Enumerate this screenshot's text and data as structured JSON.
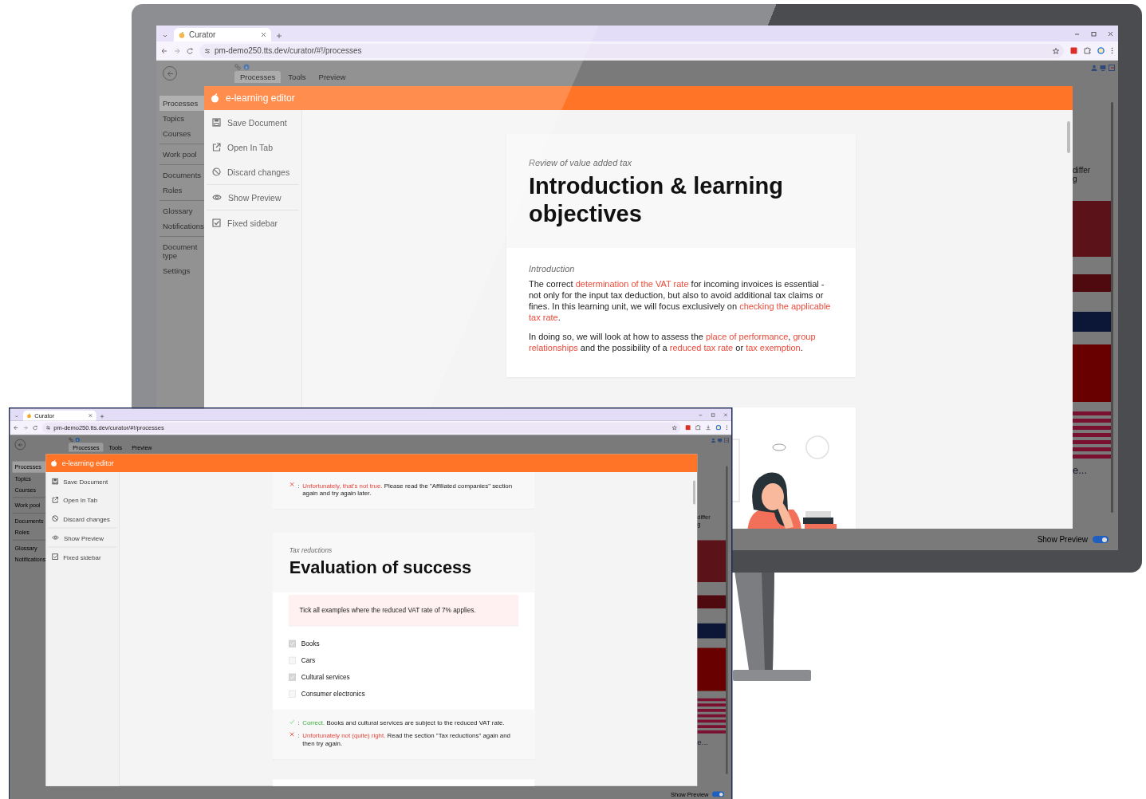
{
  "monitor_window": {
    "browser": {
      "tab_title": "Curator",
      "url": "pm-demo250.tts.dev/curator/#!/processes",
      "toolbar_icons": [
        {
          "kind": "extension"
        },
        {
          "kind": "puzzle"
        },
        {
          "kind": "profile"
        }
      ]
    },
    "app": {
      "tabs": [
        {
          "label": "Processes",
          "selected": true
        },
        {
          "label": "Tools",
          "selected": false
        },
        {
          "label": "Preview",
          "selected": false
        }
      ],
      "nav_groups": [
        [
          {
            "label": "Processes",
            "selected": true
          },
          {
            "label": "Topics",
            "selected": false
          },
          {
            "label": "Courses",
            "selected": false
          }
        ],
        [
          {
            "label": "Work pool",
            "selected": false
          }
        ],
        [
          {
            "label": "Documents",
            "selected": false
          },
          {
            "label": "Roles",
            "selected": false
          }
        ],
        [
          {
            "label": "Glossary",
            "selected": false
          },
          {
            "label": "Notifications",
            "selected": false
          }
        ],
        [
          {
            "label": "Document type",
            "selected": false
          },
          {
            "label": "Settings",
            "selected": false
          }
        ]
      ],
      "side_texts": [
        "differ",
        "g",
        "e..."
      ],
      "status": {
        "label": "Show Preview",
        "on": true
      }
    },
    "dialog": {
      "title": "e-learning editor",
      "menu_groups": [
        [
          {
            "kind": "save",
            "label": "Save Document"
          },
          {
            "kind": "open-tab",
            "label": "Open In Tab"
          },
          {
            "kind": "discard",
            "label": "Discard changes"
          }
        ],
        [
          {
            "kind": "preview",
            "label": "Show Preview"
          }
        ],
        [
          {
            "kind": "checkbox",
            "label": "Fixed sidebar",
            "checked": true
          }
        ]
      ],
      "blocks": [
        {
          "kind": "lesson",
          "subtitle": "Review of value added tax",
          "title": "Introduction & learning objectives",
          "section_label": "Introduction",
          "paragraphs": [
            [
              {
                "text": "The correct ",
                "term": false
              },
              {
                "text": "determination of the VAT rate",
                "term": true
              },
              {
                "text": " for incoming invoices is essential - not only for the input tax deduction, but also to avoid additional tax claims or fines. In this learning unit, we will focus exclusively on ",
                "term": false
              },
              {
                "text": "checking the applicable tax rate",
                "term": true
              },
              {
                "text": ".",
                "term": false
              }
            ],
            [
              {
                "text": "In doing so, we will look at how to assess the ",
                "term": false
              },
              {
                "text": "place of performance",
                "term": true
              },
              {
                "text": ", ",
                "term": false
              },
              {
                "text": "group relationships",
                "term": true
              },
              {
                "text": " and the possibility of a ",
                "term": false
              },
              {
                "text": "reduced tax rate",
                "term": true
              },
              {
                "text": " or ",
                "term": false
              },
              {
                "text": "tax exemption",
                "term": true
              },
              {
                "text": ".",
                "term": false
              }
            ]
          ]
        },
        {
          "kind": "illustration"
        }
      ]
    }
  },
  "front_window": {
    "browser": {
      "tab_title": "Curator",
      "url": "pm-demo250.tts.dev/curator/#!/processes",
      "toolbar_icons": [
        {
          "kind": "extension"
        },
        {
          "kind": "puzzle"
        },
        {
          "kind": "download"
        },
        {
          "kind": "profile"
        }
      ]
    },
    "app": {
      "tabs": [
        {
          "label": "Processes",
          "selected": true
        },
        {
          "label": "Tools",
          "selected": false
        },
        {
          "label": "Preview",
          "selected": false
        }
      ],
      "nav_groups": [
        [
          {
            "label": "Processes",
            "selected": true
          },
          {
            "label": "Topics",
            "selected": false
          },
          {
            "label": "Courses",
            "selected": false
          }
        ],
        [
          {
            "label": "Work pool",
            "selected": false
          }
        ],
        [
          {
            "label": "Documents",
            "selected": false
          },
          {
            "label": "Roles",
            "selected": false
          }
        ],
        [
          {
            "label": "Glossary",
            "selected": false
          },
          {
            "label": "Notifications",
            "selected": false
          }
        ]
      ],
      "side_texts": [
        "differ",
        "g",
        "e..."
      ],
      "status": {
        "label": "Show Preview",
        "on": true
      }
    },
    "dialog": {
      "title": "e-learning editor",
      "menu_groups": [
        [
          {
            "kind": "save",
            "label": "Save Document"
          },
          {
            "kind": "open-tab",
            "label": "Open In Tab"
          },
          {
            "kind": "discard",
            "label": "Discard changes"
          }
        ],
        [
          {
            "kind": "preview",
            "label": "Show Preview"
          }
        ],
        [
          {
            "kind": "checkbox",
            "label": "Fixed sidebar",
            "checked": true
          }
        ]
      ],
      "blocks": [
        {
          "kind": "feedback-card",
          "feedback": [
            {
              "kind": "wrong",
              "separator": ":",
              "label": "Unfortunately, that's not true.",
              "text": "Please read the \"Affiliated companies\" section again and try again later."
            }
          ]
        },
        {
          "kind": "quiz",
          "subtitle": "Tax reductions",
          "title": "Evaluation of success",
          "question": "Tick all examples where the reduced VAT rate of 7% applies.",
          "options": [
            {
              "label": "Books",
              "checked": true
            },
            {
              "label": "Cars",
              "checked": false
            },
            {
              "label": "Cultural services",
              "checked": true
            },
            {
              "label": "Consumer electronics",
              "checked": false
            }
          ],
          "feedback": [
            {
              "kind": "correct",
              "separator": ":",
              "label": "Correct.",
              "text": "Books and cultural services are subject to the reduced VAT rate."
            },
            {
              "kind": "wrong",
              "separator": ":",
              "label": "Unfortunately not (quite) right.",
              "text": "Read the section \"Tax reductions\" again and then try again."
            }
          ]
        },
        {
          "kind": "stub"
        }
      ]
    }
  }
}
